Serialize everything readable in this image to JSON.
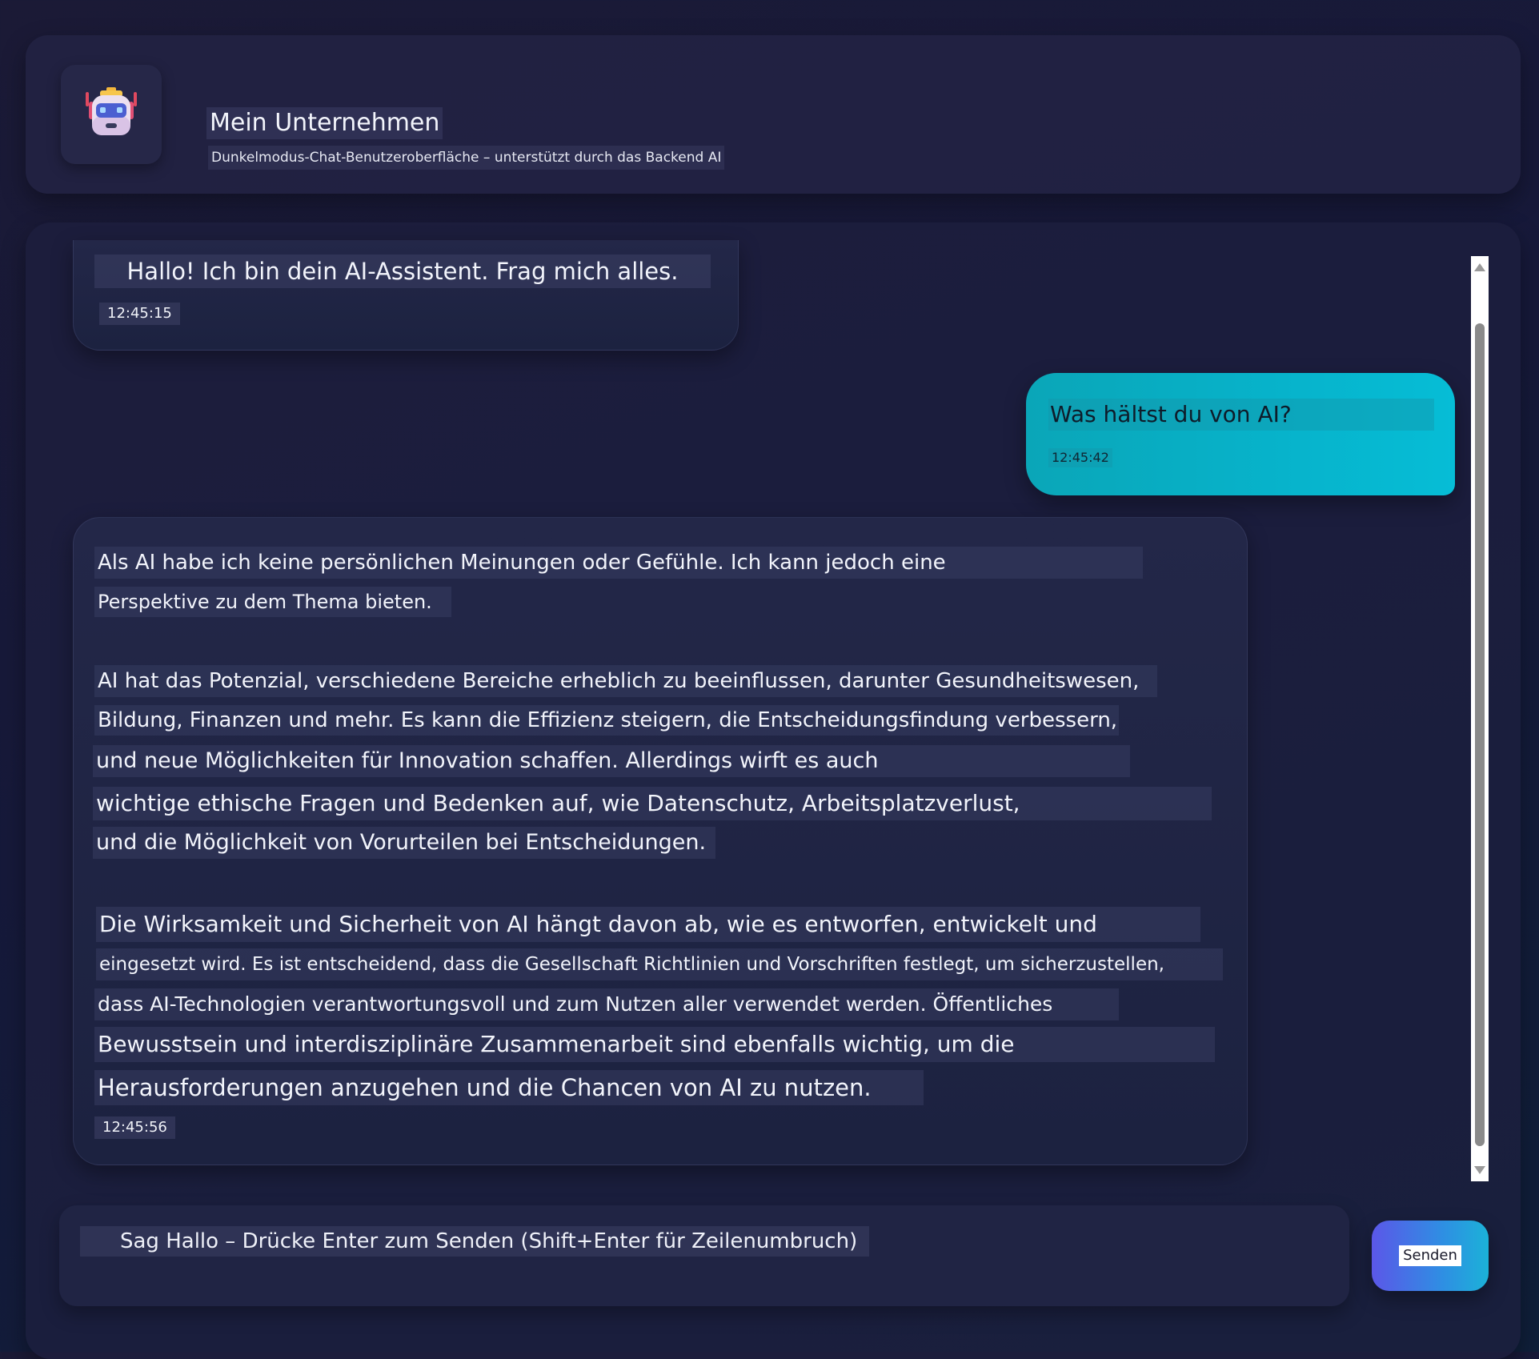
{
  "header": {
    "title": "Mein Unternehmen",
    "subtitle": "Dunkelmodus-Chat-Benutzeroberfläche – unterstützt durch das Backend AI",
    "logo_icon": "robot-icon"
  },
  "messages": [
    {
      "role": "assistant",
      "text": "Hallo! Ich bin dein AI-Assistent. Frag mich alles.",
      "time": "12:45:15"
    },
    {
      "role": "user",
      "text": "Was hältst du von AI?",
      "time": "12:45:42"
    },
    {
      "role": "assistant",
      "lines": [
        "Als AI habe ich keine persönlichen Meinungen oder Gefühle. Ich kann jedoch eine",
        "Perspektive zu dem Thema bieten.",
        "AI hat das Potenzial, verschiedene Bereiche erheblich zu beeinflussen, darunter Gesundheitswesen,",
        "Bildung, Finanzen und mehr. Es kann die Effizienz steigern, die Entscheidungsfindung verbessern,",
        "und neue Möglichkeiten für Innovation schaffen. Allerdings wirft es auch",
        "wichtige ethische Fragen und Bedenken auf, wie Datenschutz, Arbeitsplatzverlust,",
        "und die Möglichkeit von Vorurteilen bei Entscheidungen.",
        "Die Wirksamkeit und Sicherheit von AI hängt davon ab, wie es entworfen, entwickelt und",
        "eingesetzt wird. Es ist entscheidend, dass die Gesellschaft Richtlinien und Vorschriften festlegt, um sicherzustellen,",
        "dass AI-Technologien verantwortungsvoll und zum Nutzen aller verwendet werden. Öffentliches",
        "Bewusstsein und interdisziplinäre Zusammenarbeit sind ebenfalls wichtig, um die",
        "Herausforderungen anzugehen und die Chancen von AI zu nutzen."
      ],
      "time": "12:45:56"
    }
  ],
  "composer": {
    "placeholder": "Sag Hallo – Drücke Enter zum Senden (Shift+Enter für Zeilenumbruch)",
    "send_label": "Senden"
  },
  "colors": {
    "background": "#17193a",
    "user_bubble": "#07b3cb",
    "assistant_bubble": "#212644",
    "send_gradient_start": "#5b57e8",
    "send_gradient_end": "#1bb2d8"
  }
}
